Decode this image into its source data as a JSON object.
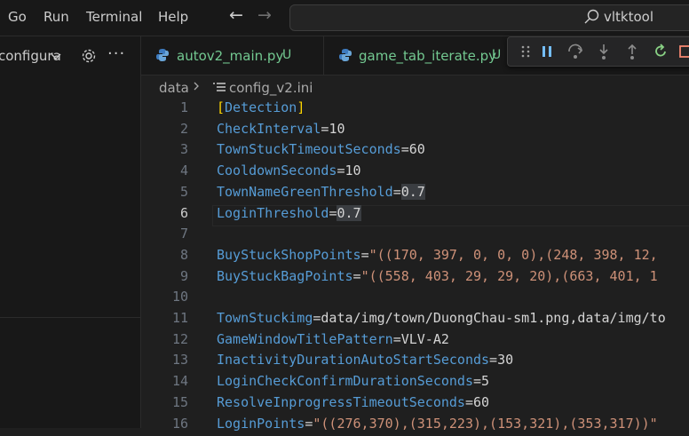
{
  "menu": [
    "Go",
    "Run",
    "Terminal",
    "Help"
  ],
  "search": {
    "text": "vltktool"
  },
  "sidebar": {
    "dropdown_label": "configura"
  },
  "tabs": [
    {
      "label": "autov2_main.py",
      "status": "U"
    },
    {
      "label": "game_tab_iterate.py",
      "status": "U"
    }
  ],
  "breadcrumb": {
    "folder": "data",
    "file": "config_v2.ini"
  },
  "editor": {
    "active_line": 6,
    "lines": [
      {
        "n": "1",
        "key": "[Detection]",
        "sep": "",
        "value": ""
      },
      {
        "n": "2",
        "key": "CheckInterval",
        "sep": "=",
        "value": "10"
      },
      {
        "n": "3",
        "key": "TownStuckTimeoutSeconds",
        "sep": "=",
        "value": "60"
      },
      {
        "n": "4",
        "key": "CooldownSeconds",
        "sep": "=",
        "value": "10"
      },
      {
        "n": "5",
        "key": "TownNameGreenThreshold",
        "sep": "=",
        "value": "0.7"
      },
      {
        "n": "6",
        "key": "LoginThreshold",
        "sep": "=",
        "value": "0.7"
      },
      {
        "n": "7",
        "key": "",
        "sep": "",
        "value": ""
      },
      {
        "n": "8",
        "key": "BuyStuckShopPoints",
        "sep": "=",
        "value": "\"((170, 397, 0, 0, 0),(248, 398, 12,"
      },
      {
        "n": "9",
        "key": "BuyStuckBagPoints",
        "sep": "=",
        "value": "\"((558, 403, 29, 29, 20),(663, 401, 1"
      },
      {
        "n": "10",
        "key": "",
        "sep": "",
        "value": ""
      },
      {
        "n": "11",
        "key": "TownStuckimg",
        "sep": "=",
        "value": "data/img/town/DuongChau-sm1.png,data/img/to"
      },
      {
        "n": "12",
        "key": "GameWindowTitlePattern",
        "sep": "=",
        "value": "VLV-A2"
      },
      {
        "n": "13",
        "key": "InactivityDurationAutoStartSeconds",
        "sep": "=",
        "value": "30"
      },
      {
        "n": "14",
        "key": "LoginCheckConfirmDurationSeconds",
        "sep": "=",
        "value": "5"
      },
      {
        "n": "15",
        "key": "ResolveInprogressTimeoutSeconds",
        "sep": "=",
        "value": "60"
      },
      {
        "n": "16",
        "key": "LoginPoints",
        "sep": "=",
        "value": "\"((276,370),(315,223),(153,321),(353,317))\""
      }
    ]
  },
  "colors": {
    "key": "#569cd6",
    "string": "#ce9178",
    "untracked": "#73c991",
    "bracket": "#ffd700"
  }
}
